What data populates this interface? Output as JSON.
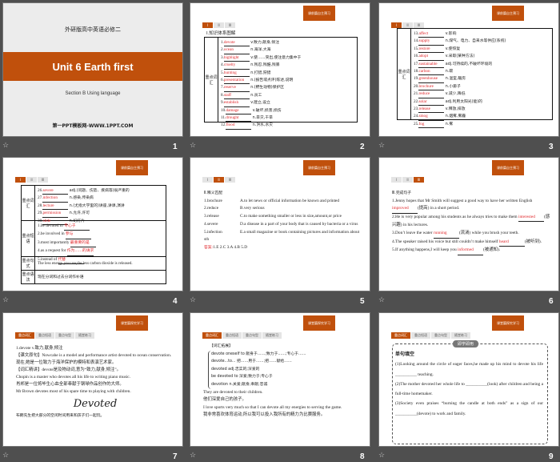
{
  "slides": [
    {
      "number": "1",
      "subtitle_cn": "外研版高中英语必修二",
      "title": "Unit 6  Earth first",
      "section": "Section B    Using language",
      "site": "第一PPT模板网-WWW.1PPT.COM"
    },
    {
      "number": "2",
      "tag": "课前篇自主预习",
      "tabs": [
        "I",
        "II",
        "III"
      ],
      "heading": "Ⅰ.知识体系图解",
      "side": "重点词汇",
      "rows": [
        [
          "1.",
          "devote",
          "v.致力,献身,倾注"
        ],
        [
          "2.",
          "ocean",
          "n.海洋,大海"
        ],
        [
          "3.",
          "highlight",
          "v.使……突出,使注意力集中于"
        ],
        [
          "4.",
          "cruelty",
          "n.残忍,残酷,残暴"
        ],
        [
          "5.",
          "hunting",
          "n.打猎,狩猎"
        ],
        [
          "6.",
          "presentation",
          "n.(报告或点评)陈述,说明"
        ],
        [
          "7.",
          "reserve",
          "n.(野生动物)保护区"
        ],
        [
          "8.",
          "staff",
          "n.员工"
        ],
        [
          "9.",
          "establish",
          "v.建立,设立"
        ],
        [
          "10.",
          "damage",
          "v.破坏,损害,损伤"
        ],
        [
          "11.",
          "drought",
          "n.旱灾,干旱"
        ],
        [
          "12.",
          "flood",
          "n.洪水,水灾"
        ]
      ]
    },
    {
      "number": "3",
      "tag": "课前篇自主预习",
      "tabs": [
        "I",
        "II",
        "III"
      ],
      "side": "重点词汇",
      "rows": [
        [
          "13.",
          "affect",
          "v.影响"
        ],
        [
          "14.",
          "supply",
          "n.煤气、电力、自来水等供应(系统)"
        ],
        [
          "15.",
          "restore",
          "v.使恢复"
        ],
        [
          "16.",
          "adopt",
          "v.采取(某种方法)"
        ],
        [
          "17.",
          "sustainable",
          "adj.可持续的,不破坏环境的"
        ],
        [
          "18.",
          "carbon",
          "n.碳"
        ],
        [
          "19.",
          "greenhouse",
          "n.温室,暖房"
        ],
        [
          "20.",
          "brochure",
          "n.小册子"
        ],
        [
          "21.",
          "reduce",
          "v.减少,降低"
        ],
        [
          "22.",
          "solar",
          "adj.利用太阳光(能)的"
        ],
        [
          "23.",
          "release",
          "v.释放,排放"
        ],
        [
          "24.",
          "smog",
          "n.烟雾,雾霾"
        ],
        [
          "25.",
          "fog",
          "n.雾"
        ]
      ]
    },
    {
      "number": "4",
      "tag": "课前篇自主预习",
      "tabs": [
        "I",
        "II",
        "III"
      ],
      "vocab_side": "重点词汇",
      "vocab": [
        [
          "26.",
          "severe",
          "adj.(问题、伤势、疾病等)很严重的"
        ],
        [
          "27.",
          "infection",
          "n.感染,传染病"
        ],
        [
          "28.",
          "lecture",
          "n.(尤指大学里的)讲座,讲课,演讲"
        ],
        [
          "29.",
          "permission",
          "n.允许,许可"
        ],
        [
          "30.",
          "slide",
          "n.幻灯片"
        ]
      ],
      "phrase_side": "重点短语",
      "phrases": [
        [
          "1.be devoted to",
          "专心于"
        ],
        [
          "2.be involved in",
          "参与"
        ],
        [
          "3.most importantly",
          "最重要的是"
        ],
        [
          "4.as a request for",
          "作为……的请求"
        ],
        [
          "5.instead of",
          "代替"
        ]
      ],
      "sentence_side": "重点句式",
      "sentence": "The less energy you use,the less carbon dioxide is released.",
      "grammar_side": "重点语法",
      "grammar": "现在分词和过去分词作补语"
    },
    {
      "number": "5",
      "tag": "课前篇自主预习",
      "tabs": [
        "I",
        "II",
        "III"
      ],
      "heading": "Ⅱ.释义匹配",
      "items": [
        [
          "1.brochure",
          "A.to let news or official information be known and printed"
        ],
        [
          "2.reduce",
          "B.very serious"
        ],
        [
          "3.release",
          "C.to make something smaller or less in size,amount,or price"
        ],
        [
          "4.severe",
          "D.a disease in a part of your body that is caused by bacteria or a virus"
        ],
        [
          "5.infection",
          "E.a small magazine or book containing pictures and information about sth"
        ]
      ],
      "answer_label": "答案:",
      "answer": "1.E   2.C   3.A   4.B   5.D"
    },
    {
      "number": "6",
      "tag": "课前篇自主预习",
      "tabs": [
        "I",
        "II",
        "III"
      ],
      "heading": "Ⅲ.完成句子",
      "items": [
        [
          "1.Jenny hopes that Mr Smith will suggest a good way to have her written English ",
          "improved",
          "(提高) in a short period."
        ],
        [
          "2.He is very popular among his students as he always tries to make them ",
          "interested",
          "(感兴趣) in his lectures."
        ],
        [
          "3.Don’t leave the water ",
          "running",
          "(流淌) while you brush your teeth."
        ],
        [
          "4.The speaker raised his voice but still couldn’t make himself ",
          "heard",
          "(被听到)."
        ],
        [
          "5.If anything happens,I will keep you ",
          "informed",
          "(被通知)."
        ]
      ]
    },
    {
      "number": "7",
      "tag": "课堂篇探究学习",
      "tabs": [
        "重点词汇",
        "重点短语",
        "重点句型",
        "随堂练习"
      ],
      "lines": [
        "1.devote v.致力,献身,倾注",
        "【课文原句】Nowcahe is a model and performance artist devoted to ocean conservation.",
        "现在,她是一位致力于海洋保护的模特和表演艺术家。",
        "【词汇精讲】devote是及物动词,意为“致力,献身,倾注”。",
        "Chopin is a master who devotes all his life to writing piano music.",
        "肖邦是一位将毕生心血全部奉献于钢琴作品创作的大师。",
        "Mr Brown devotes most of his spare time to playing with children."
      ],
      "script": "Devoted",
      "last": "布朗先生把大部分的空闲时间用来和孩子们一起玩。"
    },
    {
      "number": "8",
      "tag": "课堂篇探究学习",
      "tabs": [
        "重点词汇",
        "重点短语",
        "重点句型",
        "随堂练习"
      ],
      "heading": "【词汇拓展】",
      "brace": [
        "devote oneself to 献身于……;致力于……;专心于……",
        "devote...to... 把……用于……;把……献给……",
        "devoted adj.忠实的;深爱的",
        "be devoted to 深爱;致力于;专心于",
        "devotion n.关爱;献身;奉献;忠诚"
      ],
      "lines": [
        "They are devoted to their children.",
        "他们深爱自己的孩子。",
        "I love sports very much so that I can devote all my energies to serving the game.",
        "我非常喜欢体育运动,所以我可以投入我所有的精力为比赛服务。"
      ]
    },
    {
      "number": "9",
      "tag": "课堂篇探究学习",
      "tabs": [
        "重点词汇",
        "重点短语",
        "重点句型",
        "随堂练习"
      ],
      "box_title": "即学即用",
      "heading": "单句填空",
      "items": [
        "(1)Looking around the circle of eager faces,he made up his mind to devote his life __________ teaching.",
        "(2)The mother devoted her whole life to __________(look) after children and being a full-time homemaker.",
        "(3)Society even praises “burning the candle at both ends” as a sign of our __________(devote) to work and family."
      ]
    }
  ],
  "colors": {
    "accent": "#c0500c",
    "answer": "#e0262a",
    "background": "#4f4f4f"
  }
}
